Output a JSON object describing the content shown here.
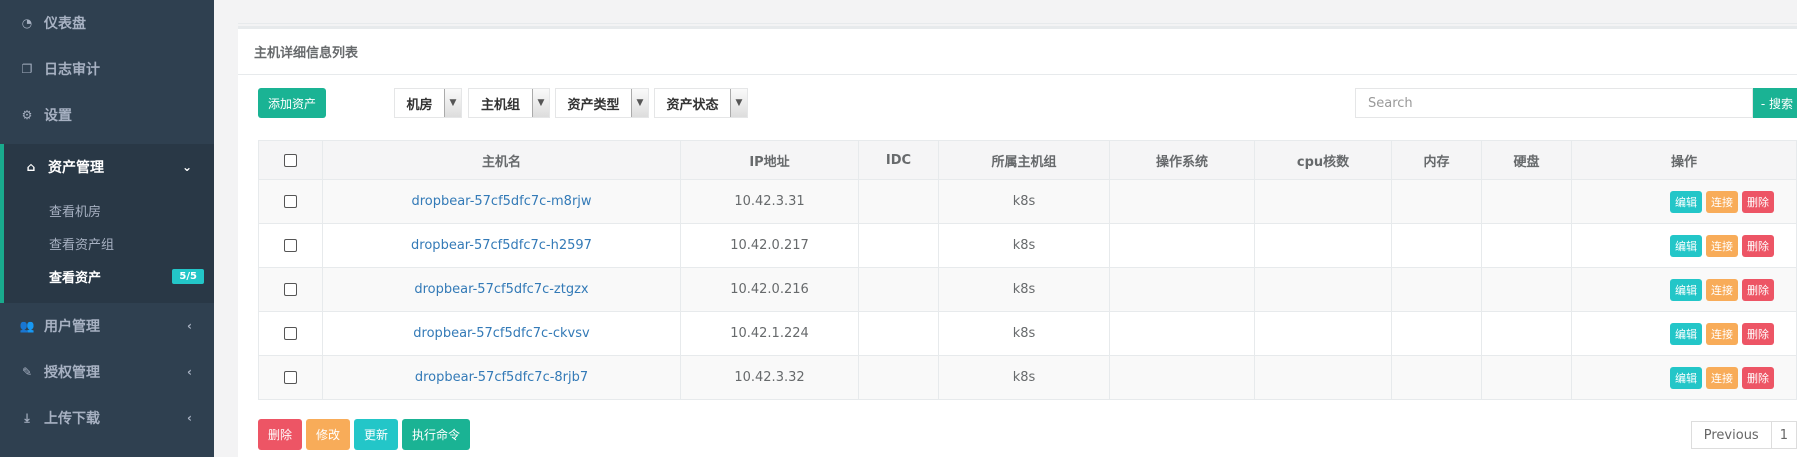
{
  "sidebar": {
    "items": [
      {
        "label": "仪表盘",
        "icon": "dashboard-icon"
      },
      {
        "label": "日志审计",
        "icon": "copy-icon"
      },
      {
        "label": "设置",
        "icon": "gears-icon"
      },
      {
        "label": "资产管理",
        "icon": "inbox-icon"
      },
      {
        "label": "用户管理",
        "icon": "users-icon"
      },
      {
        "label": "授权管理",
        "icon": "edit-icon"
      },
      {
        "label": "上传下载",
        "icon": "download-icon"
      }
    ],
    "sub_items": [
      {
        "label": "查看机房"
      },
      {
        "label": "查看资产组"
      },
      {
        "label": "查看资产",
        "badge": "5/5"
      }
    ]
  },
  "panel": {
    "title": "主机详细信息列表",
    "add_button": "添加资产",
    "filters": [
      "机房",
      "主机组",
      "资产类型",
      "资产状态"
    ],
    "search_placeholder": "Search",
    "search_button": "- 搜索 -"
  },
  "table": {
    "headers": [
      "主机名",
      "IP地址",
      "IDC",
      "所属主机组",
      "操作系统",
      "cpu核数",
      "内存",
      "硬盘",
      "操作"
    ],
    "rows": [
      {
        "host": "dropbear-57cf5dfc7c-m8rjw",
        "ip": "10.42.3.31",
        "idc": "",
        "group": "k8s",
        "os": "",
        "cpu": "",
        "mem": "",
        "disk": ""
      },
      {
        "host": "dropbear-57cf5dfc7c-h2597",
        "ip": "10.42.0.217",
        "idc": "",
        "group": "k8s",
        "os": "",
        "cpu": "",
        "mem": "",
        "disk": ""
      },
      {
        "host": "dropbear-57cf5dfc7c-ztgzx",
        "ip": "10.42.0.216",
        "idc": "",
        "group": "k8s",
        "os": "",
        "cpu": "",
        "mem": "",
        "disk": ""
      },
      {
        "host": "dropbear-57cf5dfc7c-ckvsv",
        "ip": "10.42.1.224",
        "idc": "",
        "group": "k8s",
        "os": "",
        "cpu": "",
        "mem": "",
        "disk": ""
      },
      {
        "host": "dropbear-57cf5dfc7c-8rjb7",
        "ip": "10.42.3.32",
        "idc": "",
        "group": "k8s",
        "os": "",
        "cpu": "",
        "mem": "",
        "disk": ""
      }
    ],
    "row_actions": {
      "edit": "编辑",
      "connect": "连接",
      "delete": "删除"
    }
  },
  "bottom_actions": {
    "delete": "删除",
    "modify": "修改",
    "update": "更新",
    "exec": "执行命令"
  },
  "pager": {
    "previous": "Previous",
    "page": "1"
  },
  "colors": {
    "sidebar": "#2f4050",
    "primary": "#1ab394",
    "danger": "#ed5565",
    "warning": "#f8ac59",
    "info": "#23c6c8"
  }
}
